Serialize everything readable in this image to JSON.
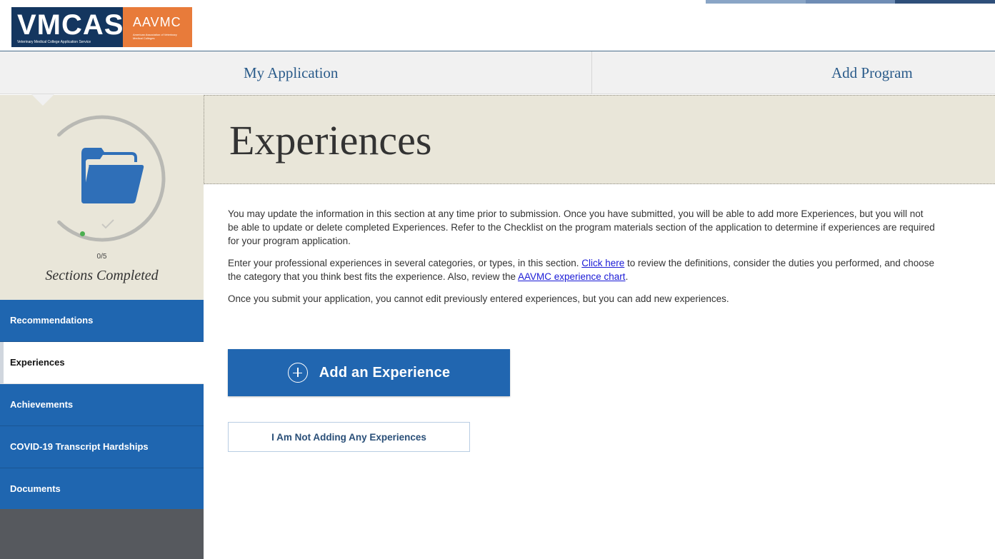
{
  "brand": {
    "logo_main": "VMCAS",
    "logo_main_sub": "Veterinary Medical College Application Service",
    "logo_partner": "AAVMC",
    "logo_partner_sub": "American Association of Veterinary Medical Colleges"
  },
  "nav": {
    "my_application": "My Application",
    "add_program": "Add Program"
  },
  "progress": {
    "completed": 0,
    "total": 5,
    "count_text": "0/5",
    "label": "Sections Completed",
    "icon": "folder-icon",
    "check_icon": "checkmark-icon"
  },
  "sidebar": {
    "items": [
      {
        "label": "Recommendations",
        "active": false
      },
      {
        "label": "Experiences",
        "active": true
      },
      {
        "label": "Achievements",
        "active": false
      },
      {
        "label": "COVID-19 Transcript Hardships",
        "active": false
      },
      {
        "label": "Documents",
        "active": false
      }
    ]
  },
  "page": {
    "title": "Experiences",
    "para1": "You may update the information in this section at any time prior to submission. Once you have submitted, you will be able to add more Experiences, but you will not be able to update or delete completed Experiences. Refer to the Checklist on the program materials section of the application to determine if experiences are required for your program application.",
    "para2_before": "Enter your professional experiences in several categories, or types, in this section. ",
    "para2_link1": "Click here",
    "para2_middle": " to review the definitions, consider the duties you performed, and choose the category that you think best fits the experience. Also, review the ",
    "para2_link2": "AAVMC experience chart",
    "para2_end": ".",
    "para3": "Once you submit your application, you cannot edit previously entered experiences, but you can add new experiences."
  },
  "actions": {
    "add_experience": "Add an Experience",
    "not_adding": "I Am Not Adding Any Experiences"
  },
  "colors": {
    "brand_navy": "#14365f",
    "brand_orange": "#e87b3a",
    "primary_blue": "#2166b0",
    "sidebar_bg": "#e9e6d9",
    "link": "#1a1ad6"
  }
}
